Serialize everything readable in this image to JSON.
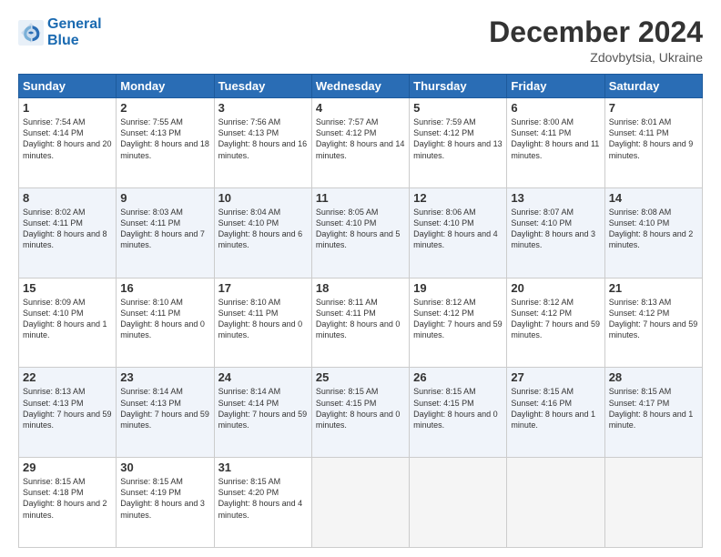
{
  "logo": {
    "line1": "General",
    "line2": "Blue"
  },
  "header": {
    "month": "December 2024",
    "location": "Zdovbytsia, Ukraine"
  },
  "weekdays": [
    "Sunday",
    "Monday",
    "Tuesday",
    "Wednesday",
    "Thursday",
    "Friday",
    "Saturday"
  ],
  "weeks": [
    [
      {
        "day": "1",
        "sunrise": "Sunrise: 7:54 AM",
        "sunset": "Sunset: 4:14 PM",
        "daylight": "Daylight: 8 hours and 20 minutes."
      },
      {
        "day": "2",
        "sunrise": "Sunrise: 7:55 AM",
        "sunset": "Sunset: 4:13 PM",
        "daylight": "Daylight: 8 hours and 18 minutes."
      },
      {
        "day": "3",
        "sunrise": "Sunrise: 7:56 AM",
        "sunset": "Sunset: 4:13 PM",
        "daylight": "Daylight: 8 hours and 16 minutes."
      },
      {
        "day": "4",
        "sunrise": "Sunrise: 7:57 AM",
        "sunset": "Sunset: 4:12 PM",
        "daylight": "Daylight: 8 hours and 14 minutes."
      },
      {
        "day": "5",
        "sunrise": "Sunrise: 7:59 AM",
        "sunset": "Sunset: 4:12 PM",
        "daylight": "Daylight: 8 hours and 13 minutes."
      },
      {
        "day": "6",
        "sunrise": "Sunrise: 8:00 AM",
        "sunset": "Sunset: 4:11 PM",
        "daylight": "Daylight: 8 hours and 11 minutes."
      },
      {
        "day": "7",
        "sunrise": "Sunrise: 8:01 AM",
        "sunset": "Sunset: 4:11 PM",
        "daylight": "Daylight: 8 hours and 9 minutes."
      }
    ],
    [
      {
        "day": "8",
        "sunrise": "Sunrise: 8:02 AM",
        "sunset": "Sunset: 4:11 PM",
        "daylight": "Daylight: 8 hours and 8 minutes."
      },
      {
        "day": "9",
        "sunrise": "Sunrise: 8:03 AM",
        "sunset": "Sunset: 4:11 PM",
        "daylight": "Daylight: 8 hours and 7 minutes."
      },
      {
        "day": "10",
        "sunrise": "Sunrise: 8:04 AM",
        "sunset": "Sunset: 4:10 PM",
        "daylight": "Daylight: 8 hours and 6 minutes."
      },
      {
        "day": "11",
        "sunrise": "Sunrise: 8:05 AM",
        "sunset": "Sunset: 4:10 PM",
        "daylight": "Daylight: 8 hours and 5 minutes."
      },
      {
        "day": "12",
        "sunrise": "Sunrise: 8:06 AM",
        "sunset": "Sunset: 4:10 PM",
        "daylight": "Daylight: 8 hours and 4 minutes."
      },
      {
        "day": "13",
        "sunrise": "Sunrise: 8:07 AM",
        "sunset": "Sunset: 4:10 PM",
        "daylight": "Daylight: 8 hours and 3 minutes."
      },
      {
        "day": "14",
        "sunrise": "Sunrise: 8:08 AM",
        "sunset": "Sunset: 4:10 PM",
        "daylight": "Daylight: 8 hours and 2 minutes."
      }
    ],
    [
      {
        "day": "15",
        "sunrise": "Sunrise: 8:09 AM",
        "sunset": "Sunset: 4:10 PM",
        "daylight": "Daylight: 8 hours and 1 minute."
      },
      {
        "day": "16",
        "sunrise": "Sunrise: 8:10 AM",
        "sunset": "Sunset: 4:11 PM",
        "daylight": "Daylight: 8 hours and 0 minutes."
      },
      {
        "day": "17",
        "sunrise": "Sunrise: 8:10 AM",
        "sunset": "Sunset: 4:11 PM",
        "daylight": "Daylight: 8 hours and 0 minutes."
      },
      {
        "day": "18",
        "sunrise": "Sunrise: 8:11 AM",
        "sunset": "Sunset: 4:11 PM",
        "daylight": "Daylight: 8 hours and 0 minutes."
      },
      {
        "day": "19",
        "sunrise": "Sunrise: 8:12 AM",
        "sunset": "Sunset: 4:12 PM",
        "daylight": "Daylight: 7 hours and 59 minutes."
      },
      {
        "day": "20",
        "sunrise": "Sunrise: 8:12 AM",
        "sunset": "Sunset: 4:12 PM",
        "daylight": "Daylight: 7 hours and 59 minutes."
      },
      {
        "day": "21",
        "sunrise": "Sunrise: 8:13 AM",
        "sunset": "Sunset: 4:12 PM",
        "daylight": "Daylight: 7 hours and 59 minutes."
      }
    ],
    [
      {
        "day": "22",
        "sunrise": "Sunrise: 8:13 AM",
        "sunset": "Sunset: 4:13 PM",
        "daylight": "Daylight: 7 hours and 59 minutes."
      },
      {
        "day": "23",
        "sunrise": "Sunrise: 8:14 AM",
        "sunset": "Sunset: 4:13 PM",
        "daylight": "Daylight: 7 hours and 59 minutes."
      },
      {
        "day": "24",
        "sunrise": "Sunrise: 8:14 AM",
        "sunset": "Sunset: 4:14 PM",
        "daylight": "Daylight: 7 hours and 59 minutes."
      },
      {
        "day": "25",
        "sunrise": "Sunrise: 8:15 AM",
        "sunset": "Sunset: 4:15 PM",
        "daylight": "Daylight: 8 hours and 0 minutes."
      },
      {
        "day": "26",
        "sunrise": "Sunrise: 8:15 AM",
        "sunset": "Sunset: 4:15 PM",
        "daylight": "Daylight: 8 hours and 0 minutes."
      },
      {
        "day": "27",
        "sunrise": "Sunrise: 8:15 AM",
        "sunset": "Sunset: 4:16 PM",
        "daylight": "Daylight: 8 hours and 1 minute."
      },
      {
        "day": "28",
        "sunrise": "Sunrise: 8:15 AM",
        "sunset": "Sunset: 4:17 PM",
        "daylight": "Daylight: 8 hours and 1 minute."
      }
    ],
    [
      {
        "day": "29",
        "sunrise": "Sunrise: 8:15 AM",
        "sunset": "Sunset: 4:18 PM",
        "daylight": "Daylight: 8 hours and 2 minutes."
      },
      {
        "day": "30",
        "sunrise": "Sunrise: 8:15 AM",
        "sunset": "Sunset: 4:19 PM",
        "daylight": "Daylight: 8 hours and 3 minutes."
      },
      {
        "day": "31",
        "sunrise": "Sunrise: 8:15 AM",
        "sunset": "Sunset: 4:20 PM",
        "daylight": "Daylight: 8 hours and 4 minutes."
      },
      null,
      null,
      null,
      null
    ]
  ]
}
